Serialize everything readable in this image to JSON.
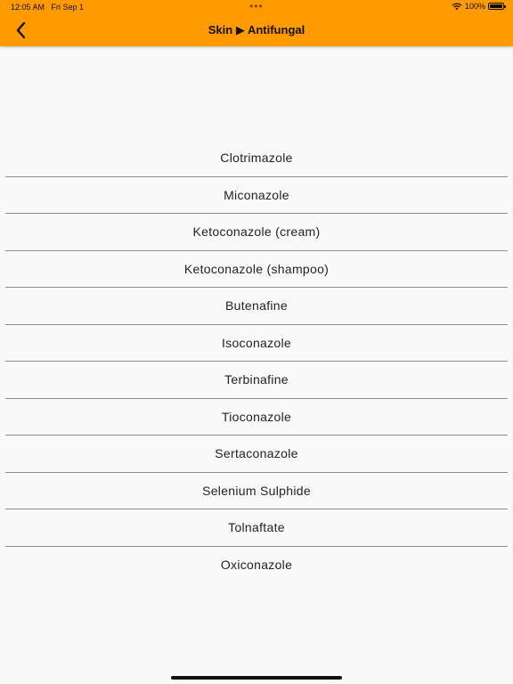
{
  "status_bar": {
    "time": "12:05 AM",
    "date": "Fri Sep 1",
    "multitask_dots": "•••",
    "battery_percent": "100%",
    "battery_level": 1.0
  },
  "nav": {
    "title": "Skin ▶ Antifungal",
    "back_icon": "chevron-left-icon"
  },
  "colors": {
    "accent": "#ff9a00",
    "background": "#f9f9f9",
    "divider": "#8c8c8c"
  },
  "items": [
    {
      "label": "Clotrimazole"
    },
    {
      "label": "Miconazole"
    },
    {
      "label": "Ketoconazole (cream)"
    },
    {
      "label": "Ketoconazole (shampoo)"
    },
    {
      "label": "Butenafine"
    },
    {
      "label": "Isoconazole"
    },
    {
      "label": "Terbinafine"
    },
    {
      "label": "Tioconazole"
    },
    {
      "label": "Sertaconazole"
    },
    {
      "label": "Selenium Sulphide"
    },
    {
      "label": "Tolnaftate"
    },
    {
      "label": "Oxiconazole"
    }
  ]
}
